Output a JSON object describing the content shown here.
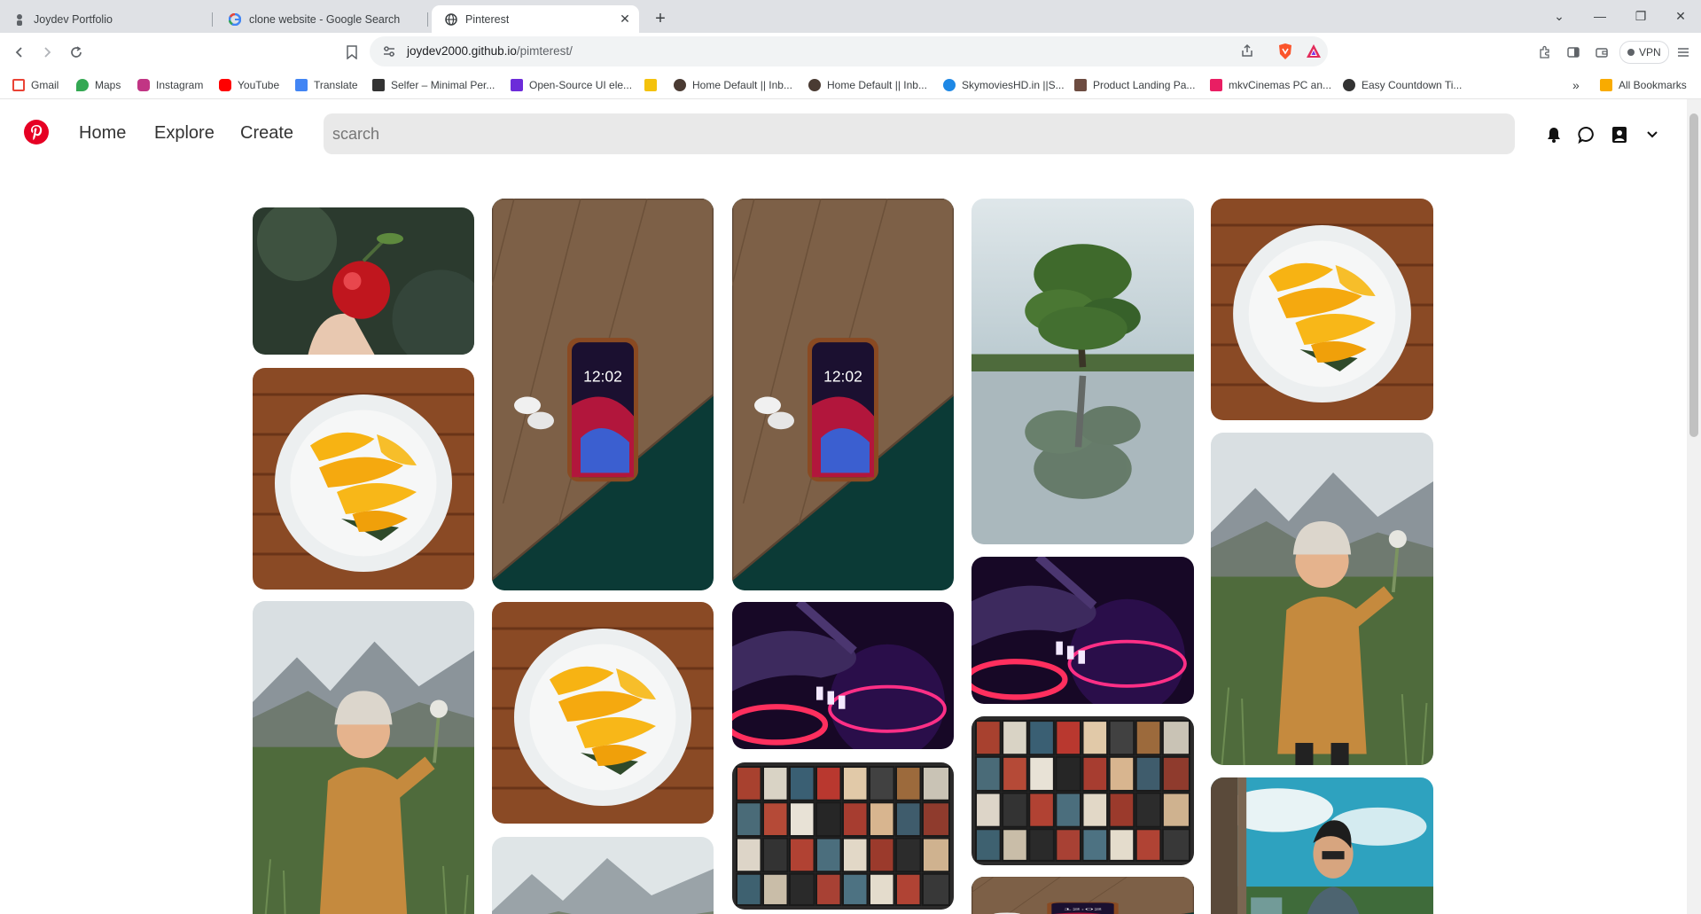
{
  "tabs": [
    {
      "label": "Joydev Portfolio",
      "state": "inactive"
    },
    {
      "label": "clone website - Google Search",
      "state": "inactive"
    },
    {
      "label": "Pinterest",
      "state": "active"
    }
  ],
  "address": {
    "domain": "joydev2000.github.io",
    "path": "/pimterest/"
  },
  "vpn_label": "VPN",
  "bookmarks": [
    {
      "label": "Gmail",
      "color": "#ea4335"
    },
    {
      "label": "Maps",
      "color": "#34a853"
    },
    {
      "label": "Instagram",
      "color": "#c13584"
    },
    {
      "label": "YouTube",
      "color": "#ff0000"
    },
    {
      "label": "Translate",
      "color": "#4285f4"
    },
    {
      "label": "Selfer – Minimal Per...",
      "color": "#333333"
    },
    {
      "label": "Open-Source UI ele...",
      "color": "#6c2bd9"
    },
    {
      "label": "",
      "color": "#f4c20d"
    },
    {
      "label": "Home Default || Inb...",
      "color": "#4a3b33"
    },
    {
      "label": "Home Default || Inb...",
      "color": "#4a3b33"
    },
    {
      "label": "SkymoviesHD.in ||S...",
      "color": "#1e88e5"
    },
    {
      "label": "Product Landing Pa...",
      "color": "#6d4c41"
    },
    {
      "label": "mkvCinemas PC an...",
      "color": "#e91e63"
    },
    {
      "label": "Easy Countdown Ti...",
      "color": "#333333"
    }
  ],
  "all_bookmarks_label": "All Bookmarks",
  "nav": {
    "home": "Home",
    "explore": "Explore",
    "create": "Create"
  },
  "search": {
    "placeholder": "scarch",
    "value": ""
  },
  "accent_color": "#e60023",
  "pins": [
    {
      "image": "apple-in-hand"
    },
    {
      "image": "mango-plate"
    },
    {
      "image": "girl-in-field"
    },
    {
      "image": "phone-on-wood"
    },
    {
      "image": "mango-plate"
    },
    {
      "image": "mountain-field"
    },
    {
      "image": "phone-on-wood"
    },
    {
      "image": "dj-turntable"
    },
    {
      "image": "movie-posters"
    },
    {
      "image": "tree-reflection"
    },
    {
      "image": "dj-turntable"
    },
    {
      "image": "movie-posters"
    },
    {
      "image": "phone-on-wood"
    },
    {
      "image": "mango-plate"
    },
    {
      "image": "girl-in-field"
    },
    {
      "image": "man-sky"
    }
  ]
}
